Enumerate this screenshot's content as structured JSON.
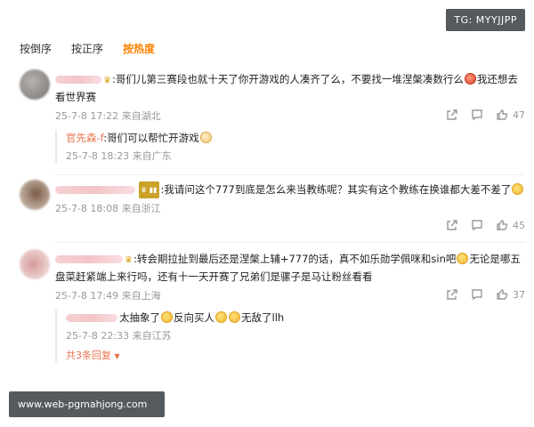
{
  "watermark_top": "TG: MYYJJPP",
  "watermark_bottom": "www.web-pgmahjong.com",
  "sort": {
    "desc_time": "按倒序",
    "asc_time": "按正序",
    "hot": "按热度"
  },
  "comments": [
    {
      "text_a": ":哥们儿第三赛段也就十天了你开游戏的人凑齐了么，不要找一堆涅槃凑数行么",
      "text_b": "我还想去看世界赛",
      "time": "25-7-8 17:22",
      "location": "来自湖北",
      "likes": "47",
      "reply": {
        "name": "官先森-f",
        "text": ":哥们可以帮忙开游戏",
        "time": "25-7-8 18:23",
        "location": "来自广东"
      }
    },
    {
      "text_a": ":我请问这个777到底是怎么来当教练呢？其实有这个教练在换谁都大差不差了",
      "time": "25-7-8 18:08",
      "location": "来自浙江",
      "likes": "45"
    },
    {
      "text_a": ":转会期拉扯到最后还是涅槃上辅+777的话，真不如乐勋学佩咪和sin吧",
      "text_b": "无论是哪五盘菜赶紧端上来行吗，还有十一天开赛了兄弟们是骡子是马让粉丝看看",
      "time": "25-7-8 17:49",
      "location": "来自上海",
      "likes": "37",
      "reply": {
        "text_a": "太抽象了",
        "text_b": "反向买人",
        "text_c": "无敌了llh",
        "time": "25-7-8 22:33",
        "location": "来自江苏"
      },
      "more_replies": "共3条回复"
    }
  ],
  "icons": {
    "share": "share-icon",
    "comment": "comment-icon",
    "like": "thumbs-up-icon"
  }
}
